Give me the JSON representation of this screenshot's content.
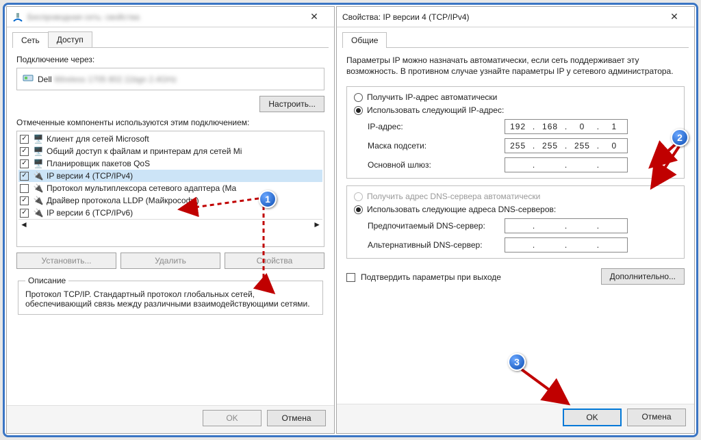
{
  "left": {
    "title": "Беспроводная сеть: свойства",
    "tabs": {
      "network": "Сеть",
      "access": "Доступ"
    },
    "connectVia": "Подключение через:",
    "adapterName": "Dell Wireless 1705 802.11bgn 2.4GHz",
    "configure": "Настроить...",
    "componentsLabel": "Отмеченные компоненты используются этим подключением:",
    "items": [
      {
        "checked": true,
        "label": "Клиент для сетей Microsoft"
      },
      {
        "checked": true,
        "label": "Общий доступ к файлам и принтерам для сетей Mi"
      },
      {
        "checked": true,
        "label": "Планировщик пакетов QoS"
      },
      {
        "checked": true,
        "label": "IP версии 4 (TCP/IPv4)"
      },
      {
        "checked": false,
        "label": "Протокол мультиплексора сетевого адаптера (Ma"
      },
      {
        "checked": true,
        "label": "Драйвер протокола LLDP (Майкрософт)"
      },
      {
        "checked": true,
        "label": "IP версии 6 (TCP/IPv6)"
      }
    ],
    "install": "Установить...",
    "uninstall": "Удалить",
    "props": "Свойства",
    "descTitle": "Описание",
    "descText": "Протокол TCP/IP. Стандартный протокол глобальных сетей, обеспечивающий связь между различными взаимодействующими сетями.",
    "ok": "OK",
    "cancel": "Отмена"
  },
  "right": {
    "title": "Свойства: IP версии 4 (TCP/IPv4)",
    "tab": "Общие",
    "info": "Параметры IP можно назначать автоматически, если сеть поддерживает эту возможность. В противном случае узнайте параметры IP у сетевого администратора.",
    "autoIp": "Получить IP-адрес автоматически",
    "useIp": "Использовать следующий IP-адрес:",
    "ipLabel": "IP-адрес:",
    "ipValue": [
      "192",
      "168",
      "0",
      "1"
    ],
    "maskLabel": "Маска подсети:",
    "maskValue": [
      "255",
      "255",
      "255",
      "0"
    ],
    "gwLabel": "Основной шлюз:",
    "gwValue": [
      "",
      "",
      "",
      ""
    ],
    "autoDns": "Получить адрес DNS-сервера автоматически",
    "useDns": "Использовать следующие адреса DNS-серверов:",
    "dns1Label": "Предпочитаемый DNS-сервер:",
    "dns1Value": [
      "",
      "",
      "",
      ""
    ],
    "dns2Label": "Альтернативный DNS-сервер:",
    "dns2Value": [
      "",
      "",
      "",
      ""
    ],
    "confirm": "Подтвердить параметры при выходе",
    "advanced": "Дополнительно...",
    "ok": "OK",
    "cancel": "Отмена"
  },
  "badges": {
    "b1": "1",
    "b2": "2",
    "b3": "3"
  }
}
